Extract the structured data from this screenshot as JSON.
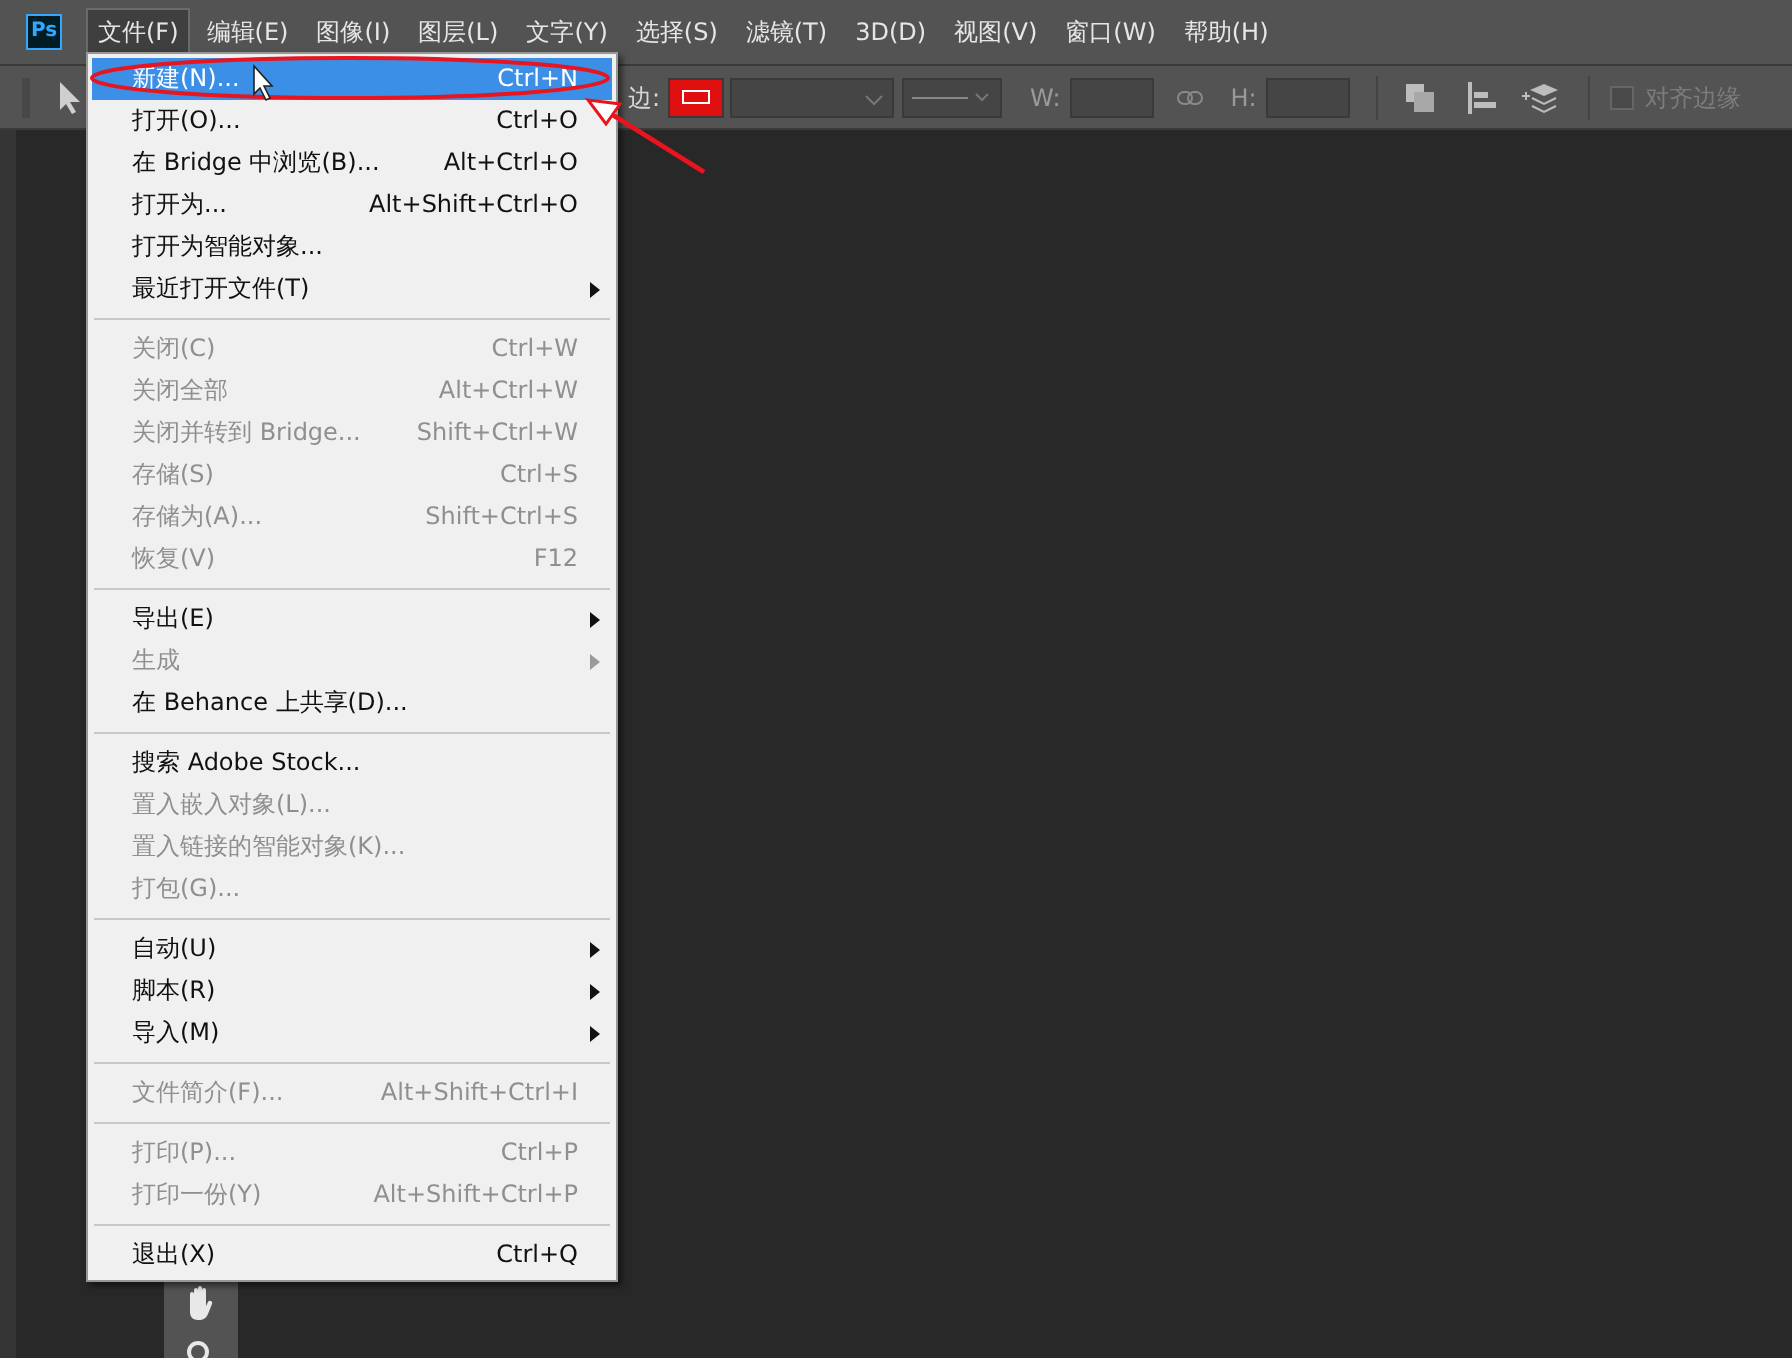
{
  "app_logo": "Ps",
  "menubar": [
    {
      "label": "文件(F)",
      "selected": true
    },
    {
      "label": "编辑(E)",
      "selected": false
    },
    {
      "label": "图像(I)",
      "selected": false
    },
    {
      "label": "图层(L)",
      "selected": false
    },
    {
      "label": "文字(Y)",
      "selected": false
    },
    {
      "label": "选择(S)",
      "selected": false
    },
    {
      "label": "滤镜(T)",
      "selected": false
    },
    {
      "label": "3D(D)",
      "selected": false
    },
    {
      "label": "视图(V)",
      "selected": false
    },
    {
      "label": "窗口(W)",
      "selected": false
    },
    {
      "label": "帮助(H)",
      "selected": false
    }
  ],
  "options_bar": {
    "stroke_label": "边:",
    "w_label": "W:",
    "h_label": "H:",
    "align_edges": {
      "label": "对齐边缘",
      "checked": false,
      "disabled": true
    }
  },
  "file_menu": [
    [
      {
        "label": "新建(N)...",
        "shortcut": "Ctrl+N",
        "disabled": false,
        "submenu": false,
        "selected": true
      },
      {
        "label": "打开(O)...",
        "shortcut": "Ctrl+O",
        "disabled": false,
        "submenu": false,
        "selected": false
      },
      {
        "label": "在 Bridge 中浏览(B)...",
        "shortcut": "Alt+Ctrl+O",
        "disabled": false,
        "submenu": false,
        "selected": false
      },
      {
        "label": "打开为...",
        "shortcut": "Alt+Shift+Ctrl+O",
        "disabled": false,
        "submenu": false,
        "selected": false
      },
      {
        "label": "打开为智能对象...",
        "disabled": false,
        "submenu": false,
        "selected": false
      },
      {
        "label": "最近打开文件(T)",
        "disabled": false,
        "submenu": true,
        "selected": false
      }
    ],
    [
      {
        "label": "关闭(C)",
        "shortcut": "Ctrl+W",
        "disabled": true,
        "submenu": false,
        "selected": false
      },
      {
        "label": "关闭全部",
        "shortcut": "Alt+Ctrl+W",
        "disabled": true,
        "submenu": false,
        "selected": false
      },
      {
        "label": "关闭并转到 Bridge...",
        "shortcut": "Shift+Ctrl+W",
        "disabled": true,
        "submenu": false,
        "selected": false
      },
      {
        "label": "存储(S)",
        "shortcut": "Ctrl+S",
        "disabled": true,
        "submenu": false,
        "selected": false
      },
      {
        "label": "存储为(A)...",
        "shortcut": "Shift+Ctrl+S",
        "disabled": true,
        "submenu": false,
        "selected": false
      },
      {
        "label": "恢复(V)",
        "shortcut": "F12",
        "disabled": true,
        "submenu": false,
        "selected": false
      }
    ],
    [
      {
        "label": "导出(E)",
        "disabled": false,
        "submenu": true,
        "selected": false
      },
      {
        "label": "生成",
        "disabled": true,
        "submenu": true,
        "selected": false
      },
      {
        "label": "在 Behance 上共享(D)...",
        "disabled": false,
        "submenu": false,
        "selected": false
      }
    ],
    [
      {
        "label": "搜索 Adobe Stock...",
        "disabled": false,
        "submenu": false,
        "selected": false
      },
      {
        "label": "置入嵌入对象(L)...",
        "disabled": true,
        "submenu": false,
        "selected": false
      },
      {
        "label": "置入链接的智能对象(K)...",
        "disabled": true,
        "submenu": false,
        "selected": false
      },
      {
        "label": "打包(G)...",
        "disabled": true,
        "submenu": false,
        "selected": false
      }
    ],
    [
      {
        "label": "自动(U)",
        "disabled": false,
        "submenu": true,
        "selected": false
      },
      {
        "label": "脚本(R)",
        "disabled": false,
        "submenu": true,
        "selected": false
      },
      {
        "label": "导入(M)",
        "disabled": false,
        "submenu": true,
        "selected": false
      }
    ],
    [
      {
        "label": "文件简介(F)...",
        "shortcut": "Alt+Shift+Ctrl+I",
        "disabled": true,
        "submenu": false,
        "selected": false
      }
    ],
    [
      {
        "label": "打印(P)...",
        "shortcut": "Ctrl+P",
        "disabled": true,
        "submenu": false,
        "selected": false
      },
      {
        "label": "打印一份(Y)",
        "shortcut": "Alt+Shift+Ctrl+P",
        "disabled": true,
        "submenu": false,
        "selected": false
      }
    ],
    [
      {
        "label": "退出(X)",
        "shortcut": "Ctrl+Q",
        "disabled": false,
        "submenu": false,
        "selected": false
      }
    ]
  ]
}
